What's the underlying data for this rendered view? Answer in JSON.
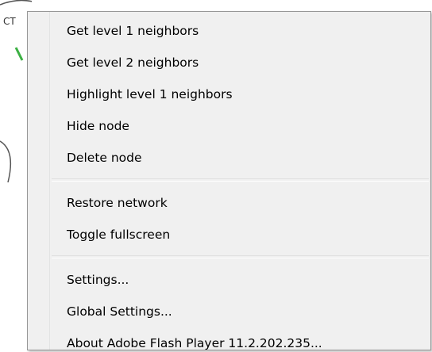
{
  "background": {
    "node_label_fragment": "CT"
  },
  "context_menu": {
    "groups": [
      {
        "items": [
          {
            "label": "Get level 1 neighbors"
          },
          {
            "label": "Get level 2 neighbors"
          },
          {
            "label": "Highlight level 1 neighbors"
          },
          {
            "label": "Hide node"
          },
          {
            "label": "Delete node"
          }
        ]
      },
      {
        "items": [
          {
            "label": "Restore network"
          },
          {
            "label": "Toggle fullscreen"
          }
        ]
      },
      {
        "items": [
          {
            "label": "Settings..."
          },
          {
            "label": "Global Settings..."
          },
          {
            "label": "About Adobe Flash Player 11.2.202.235..."
          }
        ]
      }
    ]
  },
  "colors": {
    "menu_background": "#f0f0f0",
    "menu_border": "#979797",
    "node_outline": "#555555",
    "edge_green": "#3cb043",
    "edge_blue": "#5aa9d6"
  }
}
